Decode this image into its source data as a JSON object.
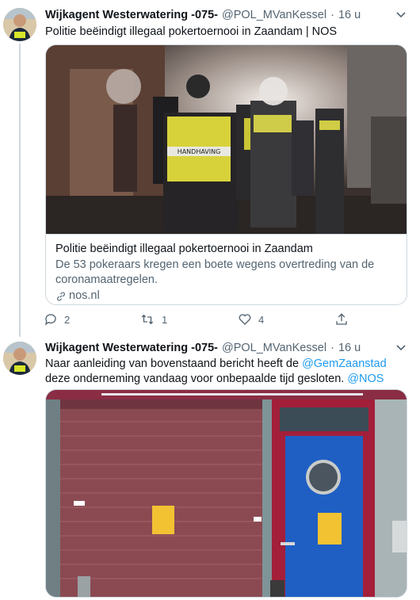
{
  "tweets": [
    {
      "author_name": "Wijkagent Westerwatering -075-",
      "handle": "@POL_MVanKessel",
      "separator": "·",
      "time": "16 u",
      "text": "Politie beëindigt illegaal pokertoernooi in Zaandam | NOS",
      "card": {
        "title": "Politie beëindigt illegaal pokertoernooi in Zaandam",
        "description": "De 53 pokeraars kregen een boete wegens overtreding van de coronamaatregelen.",
        "domain": "nos.nl",
        "vest_text": "HANDHAVING"
      },
      "actions": {
        "reply": "2",
        "retweet": "1",
        "like": "4"
      }
    },
    {
      "author_name": "Wijkagent Westerwatering -075-",
      "handle": "@POL_MVanKessel",
      "separator": "·",
      "time": "16 u",
      "text_part1": "Naar aanleiding van bovenstaand bericht heeft de ",
      "mention1": "@GemZaanstad",
      "text_part2": "  deze onderneming vandaag voor onbepaalde tijd gesloten. ",
      "mention2": "@NOS"
    }
  ],
  "colors": {
    "link": "#1d9bf0",
    "muted": "#536471",
    "border": "#cfd9de",
    "door_blue": "#1f5fc4",
    "door_frame": "#a31f3a",
    "shutter": "#8b4a4a"
  },
  "icons": [
    "reply-icon",
    "retweet-icon",
    "like-icon",
    "share-icon",
    "link-icon",
    "chevron-down-icon"
  ]
}
